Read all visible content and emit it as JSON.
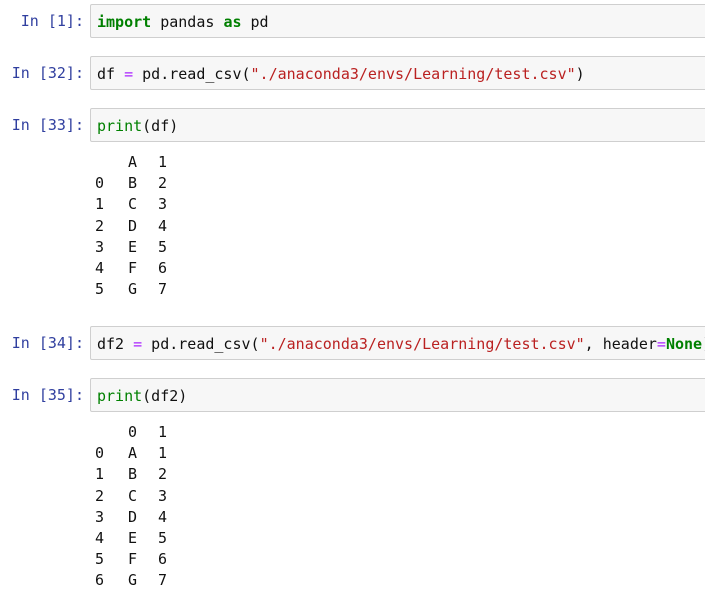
{
  "cells": [
    {
      "prompt": "In [1]:",
      "tokens": [
        {
          "t": "import",
          "c": "kw"
        },
        {
          "t": " pandas ",
          "c": ""
        },
        {
          "t": "as",
          "c": "kw"
        },
        {
          "t": " pd",
          "c": ""
        }
      ]
    },
    {
      "prompt": "In [32]:",
      "tokens": [
        {
          "t": "df ",
          "c": ""
        },
        {
          "t": "=",
          "c": "op"
        },
        {
          "t": " pd.read_csv(",
          "c": ""
        },
        {
          "t": "\"./anaconda3/envs/Learning/test.csv\"",
          "c": "str"
        },
        {
          "t": ")",
          "c": ""
        }
      ]
    },
    {
      "prompt": "In [33]:",
      "tokens": [
        {
          "t": "print",
          "c": "bi"
        },
        {
          "t": "(df)",
          "c": ""
        }
      ],
      "output": {
        "header": [
          "",
          "A",
          "1"
        ],
        "rows": [
          [
            "0",
            "B",
            "2"
          ],
          [
            "1",
            "C",
            "3"
          ],
          [
            "2",
            "D",
            "4"
          ],
          [
            "3",
            "E",
            "5"
          ],
          [
            "4",
            "F",
            "6"
          ],
          [
            "5",
            "G",
            "7"
          ]
        ]
      }
    },
    {
      "prompt": "In [34]:",
      "tokens": [
        {
          "t": "df2 ",
          "c": ""
        },
        {
          "t": "=",
          "c": "op"
        },
        {
          "t": " pd.read_csv(",
          "c": ""
        },
        {
          "t": "\"./anaconda3/envs/Learning/test.csv\"",
          "c": "str"
        },
        {
          "t": ", header",
          "c": ""
        },
        {
          "t": "=",
          "c": "op"
        },
        {
          "t": "None",
          "c": "kw"
        },
        {
          "t": ")",
          "c": ""
        }
      ]
    },
    {
      "prompt": "In [35]:",
      "tokens": [
        {
          "t": "print",
          "c": "bi"
        },
        {
          "t": "(df2)",
          "c": ""
        }
      ],
      "output": {
        "header": [
          "",
          "0",
          "1"
        ],
        "rows": [
          [
            "0",
            "A",
            "1"
          ],
          [
            "1",
            "B",
            "2"
          ],
          [
            "2",
            "C",
            "3"
          ],
          [
            "3",
            "D",
            "4"
          ],
          [
            "4",
            "E",
            "5"
          ],
          [
            "5",
            "F",
            "6"
          ],
          [
            "6",
            "G",
            "7"
          ]
        ]
      }
    }
  ]
}
